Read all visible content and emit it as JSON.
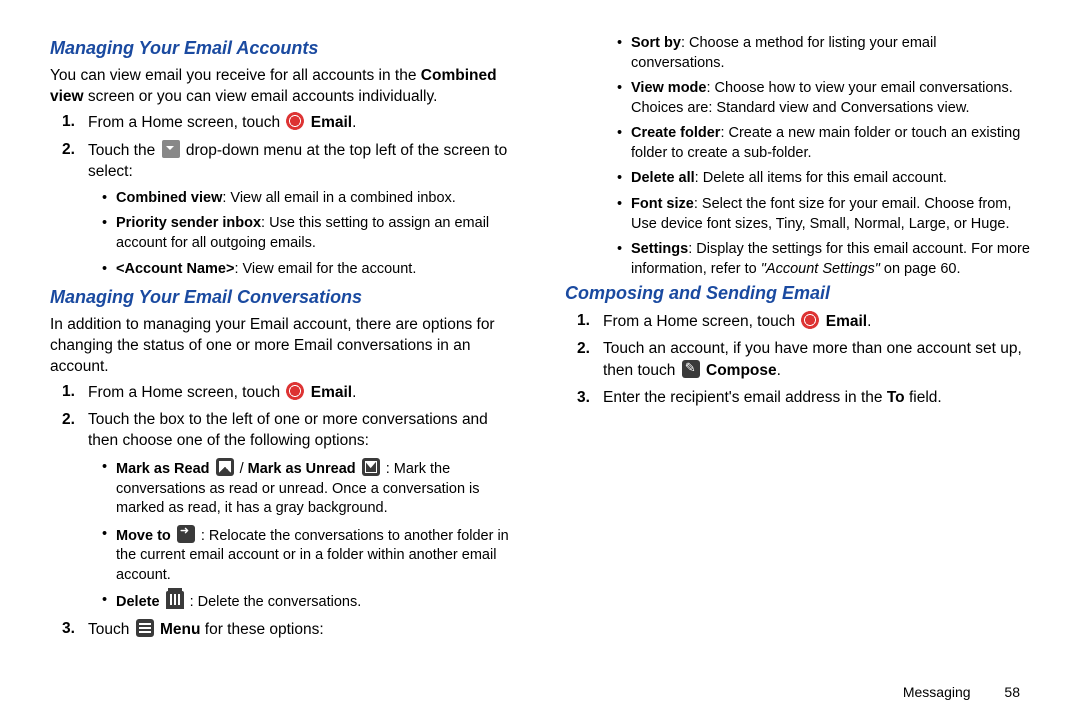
{
  "sections": {
    "s1": {
      "heading": "Managing Your Email Accounts",
      "intro_a": "You can view email you receive for all accounts in the ",
      "intro_b": "Combined view",
      "intro_c": " screen or you can view email accounts individually.",
      "step1_a": "From a Home screen, touch ",
      "step1_b": "Email",
      "step2_a": "Touch the ",
      "step2_b": " drop-down menu at the top left of the screen to select:",
      "opt1_a": "Combined view",
      "opt1_b": ": View all email in a combined inbox.",
      "opt2_a": "Priority sender inbox",
      "opt2_b": ": Use this setting to assign an email account for all outgoing emails.",
      "opt3_a": "<Account Name>",
      "opt3_b": ": View email for the account."
    },
    "s2": {
      "heading": "Managing Your Email Conversations",
      "intro": "In addition to managing your Email account, there are options for changing the status of one or more Email conversations in an account.",
      "step1_a": "From a Home screen, touch ",
      "step1_b": "Email",
      "step2": "Touch the box to the left of one or more conversations and then choose one of the following options:",
      "opt_mark_a": "Mark as Read",
      "opt_mark_b": " / ",
      "opt_mark_c": "Mark as Unread",
      "opt_mark_d": " : Mark the conversations as read or unread. Once a conversation is marked as read, it has a gray background.",
      "opt_move_a": "Move to",
      "opt_move_b": " : Relocate the conversations to another folder in the current email account or in a folder within another email account.",
      "opt_del_a": "Delete",
      "opt_del_b": " : Delete the conversations.",
      "step3_a": "Touch ",
      "step3_b": "Menu",
      "step3_c": " for these options:",
      "m1_a": "Sort by",
      "m1_b": ": Choose a method for listing your email conversations.",
      "m2_a": "View mode",
      "m2_b": ": Choose how to view your email conversations. Choices are: Standard view and Conversations view.",
      "m3_a": "Create folder",
      "m3_b": ": Create a new main folder or touch an existing folder to create a sub-folder.",
      "m4_a": "Delete all",
      "m4_b": ": Delete all items for this email account.",
      "m5_a": "Font size",
      "m5_b": ": Select the font size for your email. Choose from, Use device font sizes, Tiny, Small, Normal, Large, or Huge.",
      "m6_a": "Settings",
      "m6_b": ": Display the settings for this email account. For more information, refer to ",
      "m6_c": "\"Account Settings\"",
      "m6_d": " on page 60."
    },
    "s3": {
      "heading": "Composing and Sending Email",
      "step1_a": "From a Home screen, touch ",
      "step1_b": "Email",
      "step2_a": "Touch an account, if you have more than one account set up, then touch ",
      "step2_b": "Compose",
      "step3_a": "Enter the recipient's email address in the ",
      "step3_b": "To",
      "step3_c": " field."
    }
  },
  "footer": {
    "chapter": "Messaging",
    "page": "58"
  }
}
